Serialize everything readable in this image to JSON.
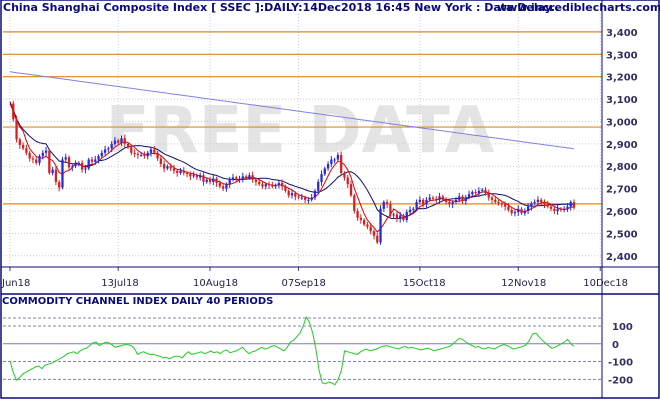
{
  "header": {
    "title": "China Shanghai Composite Index [ SSEC ]:DAILY:14Dec2018 16:45 New York : Data Delay..",
    "site": "www.incrediblecharts.com"
  },
  "watermark": "FREE DATA",
  "indicator": {
    "title": "COMMODITY CHANNEL INDEX DAILY 40 PERIODS"
  },
  "colors": {
    "background": "#ffffff",
    "up": "#2a2ad6",
    "down": "#d42020",
    "ma_fast": "#e00000",
    "ma_slow": "#101070",
    "ma_long": "#8080e0",
    "level_line": "#e08a20",
    "grid": "#c8c8e8",
    "cci": "#22cc22",
    "frame": "#0a0a78",
    "watermark": "#e4e4e4"
  },
  "chart_data": [
    {
      "type": "candlestick",
      "title": "China Shanghai Composite Index [ SSEC ]:DAILY:14Dec2018 16:45 New York : Data Delay..",
      "ylim": [
        2350,
        3480
      ],
      "y_ticks": [
        "2,400",
        "2,500",
        "2,600",
        "2,700",
        "2,800",
        "2,900",
        "3,000",
        "3,100",
        "3,200",
        "3,300",
        "3,400"
      ],
      "x_ticks": [
        "Jun18",
        "13Jul18",
        "10Aug18",
        "07Sep18",
        "15Oct18",
        "12Nov18",
        "10Dec18"
      ],
      "x_tick_index": [
        0,
        33,
        61,
        88,
        125,
        155,
        180
      ],
      "horizontal_levels": [
        3400,
        3300,
        3200,
        2975,
        2632
      ],
      "series_close": [
        3080,
        3010,
        2920,
        2895,
        2880,
        2860,
        2835,
        2830,
        2815,
        2845,
        2860,
        2870,
        2770,
        2785,
        2730,
        2705,
        2830,
        2840,
        2795,
        2800,
        2810,
        2815,
        2785,
        2790,
        2830,
        2820,
        2830,
        2845,
        2860,
        2875,
        2880,
        2900,
        2915,
        2905,
        2925,
        2900,
        2885,
        2860,
        2855,
        2850,
        2850,
        2845,
        2860,
        2875,
        2860,
        2835,
        2810,
        2790,
        2800,
        2790,
        2780,
        2770,
        2780,
        2770,
        2765,
        2755,
        2760,
        2750,
        2760,
        2730,
        2740,
        2730,
        2745,
        2725,
        2710,
        2700,
        2720,
        2740,
        2750,
        2740,
        2745,
        2755,
        2750,
        2760,
        2740,
        2730,
        2720,
        2710,
        2720,
        2715,
        2710,
        2715,
        2725,
        2710,
        2690,
        2670,
        2680,
        2665,
        2660,
        2660,
        2650,
        2650,
        2660,
        2690,
        2730,
        2765,
        2790,
        2810,
        2830,
        2830,
        2850,
        2770,
        2750,
        2720,
        2670,
        2600,
        2570,
        2560,
        2540,
        2530,
        2510,
        2490,
        2460,
        2610,
        2640,
        2630,
        2580,
        2585,
        2565,
        2580,
        2560,
        2595,
        2605,
        2610,
        2640,
        2650,
        2630,
        2650,
        2660,
        2655,
        2650,
        2665,
        2650,
        2640,
        2630,
        2640,
        2650,
        2665,
        2645,
        2660,
        2675,
        2685,
        2680,
        2690,
        2695,
        2680,
        2660,
        2650,
        2640,
        2635,
        2630,
        2620,
        2605,
        2590,
        2595,
        2610,
        2590,
        2600,
        2620,
        2635,
        2640,
        2650,
        2640,
        2630,
        2620,
        2610,
        2600,
        2610,
        2605,
        2610,
        2620,
        2640,
        2615
      ],
      "y_min_close": 2460,
      "y_max_close": 3080
    },
    {
      "type": "line",
      "title": "COMMODITY CHANNEL INDEX DAILY 40 PERIODS",
      "ylim": [
        -260,
        190
      ],
      "y_ticks": [
        "100",
        "0",
        "-100",
        "-200"
      ],
      "levels": [
        100,
        0,
        -100,
        -200
      ],
      "series": [
        {
          "values": [
            -95,
            -160,
            -205,
            -190,
            -170,
            -160,
            -150,
            -140,
            -130,
            -125,
            -140,
            -120,
            -115,
            -110,
            -100,
            -90,
            -80,
            -70,
            -55,
            -50,
            -45,
            -55,
            -40,
            -30,
            -25,
            -10,
            5,
            10,
            -10,
            0,
            10,
            5,
            -5,
            -20,
            -15,
            -10,
            -5,
            -5,
            -10,
            -25,
            -60,
            -50,
            -45,
            -55,
            -60,
            -60,
            -65,
            -70,
            -80,
            -75,
            -85,
            -75,
            -70,
            -70,
            -80,
            -60,
            -45,
            -60,
            -55,
            -50,
            -45,
            -55,
            -50,
            -40,
            -50,
            -45,
            -55,
            -40,
            -35,
            -50,
            -45,
            -40,
            -30,
            -20,
            -40,
            -55,
            -45,
            -40,
            -30,
            -20,
            -30,
            -25,
            -15,
            -10,
            -20,
            -30,
            -40,
            -20,
            10,
            20,
            40,
            60,
            100,
            150,
            120,
            60,
            -30,
            -150,
            -220,
            -225,
            -215,
            -220,
            -230,
            -200,
            -150,
            -40,
            -45,
            -50,
            -55,
            -60,
            -45,
            -35,
            -30,
            -40,
            -35,
            -30,
            -20,
            -15,
            -10,
            -15,
            -20,
            -25,
            -30,
            -20,
            -15,
            -25,
            -20,
            -25,
            -30,
            -35,
            -30,
            -25,
            -30,
            -40,
            -35,
            -30,
            -25,
            -20,
            -15,
            0,
            15,
            30,
            25,
            10,
            0,
            -10,
            -20,
            -15,
            -25,
            -30,
            -20,
            -25,
            -30,
            -20,
            -10,
            -5,
            -10,
            -20,
            -30,
            -25,
            -20,
            -15,
            -5,
            20,
            55,
            60,
            40,
            20,
            5,
            -10,
            -25,
            -20,
            -10,
            0,
            10,
            25,
            0,
            -15
          ]
        }
      ]
    }
  ]
}
